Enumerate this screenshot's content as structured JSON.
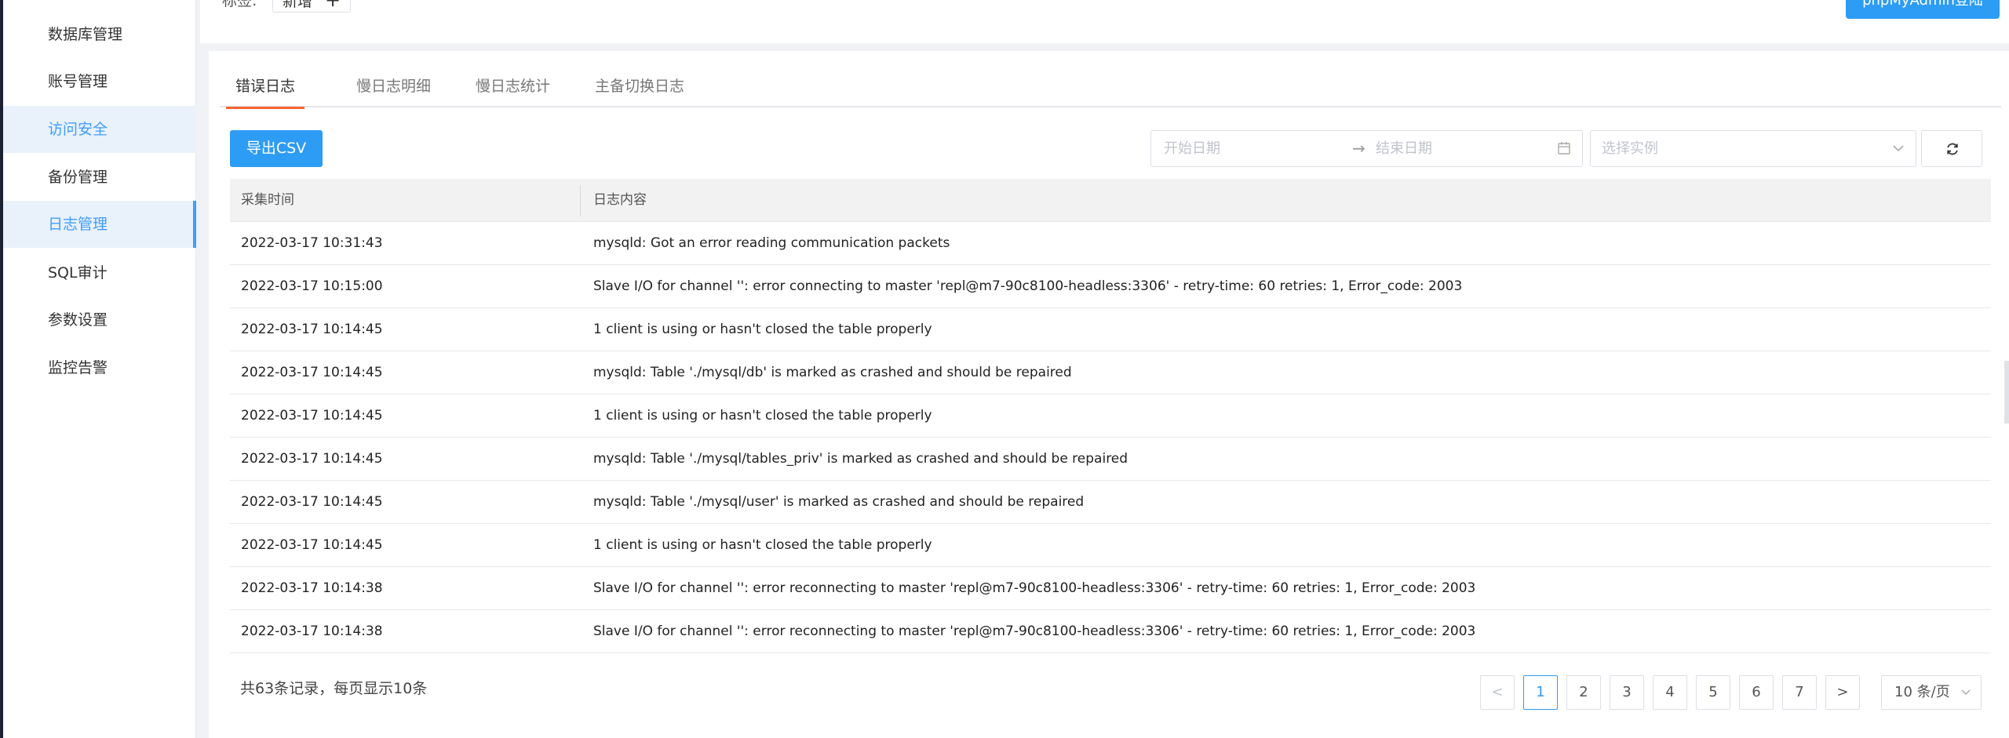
{
  "top": {
    "label": "标签:",
    "tag": "新增",
    "tag_plus": "+",
    "right_button": "phpMyAdmin登陆"
  },
  "sidebar": {
    "items": [
      {
        "label": "数据库管理"
      },
      {
        "label": "账号管理"
      },
      {
        "label": "访问安全"
      },
      {
        "label": "备份管理"
      },
      {
        "label": "日志管理"
      },
      {
        "label": "SQL审计"
      },
      {
        "label": "参数设置"
      },
      {
        "label": "监控告警"
      }
    ]
  },
  "tabs": [
    {
      "label": "错误日志"
    },
    {
      "label": "慢日志明细"
    },
    {
      "label": "慢日志统计"
    },
    {
      "label": "主备切换日志"
    }
  ],
  "toolbar": {
    "export_label": "导出CSV",
    "start_placeholder": "开始日期",
    "range_separator": "→",
    "end_placeholder": "结束日期",
    "instance_placeholder": "选择实例"
  },
  "table": {
    "headers": [
      "采集时间",
      "日志内容"
    ],
    "rows": [
      {
        "time": "2022-03-17 10:31:43",
        "content": "mysqld: Got an error reading communication packets"
      },
      {
        "time": "2022-03-17 10:15:00",
        "content": "Slave I/O for channel '': error connecting to master 'repl@m7-90c8100-headless:3306' - retry-time: 60 retries: 1, Error_code: 2003"
      },
      {
        "time": "2022-03-17 10:14:45",
        "content": "1 client is using or hasn't closed the table properly"
      },
      {
        "time": "2022-03-17 10:14:45",
        "content": "mysqld: Table './mysql/db' is marked as crashed and should be repaired"
      },
      {
        "time": "2022-03-17 10:14:45",
        "content": "1 client is using or hasn't closed the table properly"
      },
      {
        "time": "2022-03-17 10:14:45",
        "content": "mysqld: Table './mysql/tables_priv' is marked as crashed and should be repaired"
      },
      {
        "time": "2022-03-17 10:14:45",
        "content": "mysqld: Table './mysql/user' is marked as crashed and should be repaired"
      },
      {
        "time": "2022-03-17 10:14:45",
        "content": "1 client is using or hasn't closed the table properly"
      },
      {
        "time": "2022-03-17 10:14:38",
        "content": "Slave I/O for channel '': error reconnecting to master 'repl@m7-90c8100-headless:3306' - retry-time: 60 retries: 1, Error_code: 2003"
      },
      {
        "time": "2022-03-17 10:14:38",
        "content": "Slave I/O for channel '': error reconnecting to master 'repl@m7-90c8100-headless:3306' - retry-time: 60 retries: 1, Error_code: 2003"
      }
    ]
  },
  "footer": {
    "total_text": "共63条记录，每页显示10条",
    "prev": "<",
    "pages": [
      "1",
      "2",
      "3",
      "4",
      "5",
      "6",
      "7"
    ],
    "next": ">",
    "page_size": "10 条/页"
  },
  "colors": {
    "accent": "#2d9cf4",
    "active_tab_underline": "#f5652e",
    "sidebar_active_bg": "#e9f1fb",
    "sidebar_active_text": "#409eff"
  }
}
